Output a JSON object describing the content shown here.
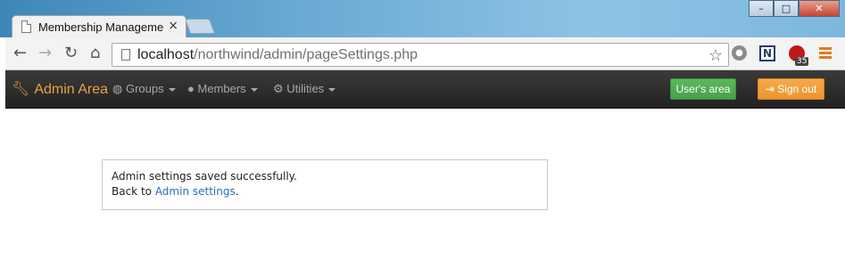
{
  "browser": {
    "tab_title": "Membership Managemen",
    "tab_close": "×",
    "window_buttons": {
      "minimize": "–",
      "maximize": "□",
      "close": "✕"
    },
    "url_host": "localhost",
    "url_path": "/northwind/admin/pageSettings.php",
    "extension_badge": "35",
    "extension_n_label": "N"
  },
  "navbar": {
    "brand": "Admin Area",
    "items": [
      {
        "label": "Groups",
        "icon": "globe-icon"
      },
      {
        "label": "Members",
        "icon": "user-icon"
      },
      {
        "label": "Utilities",
        "icon": "cog-icon"
      }
    ],
    "users_area_label": "User's area",
    "sign_out_label": "Sign out"
  },
  "message": {
    "line1": "Admin settings saved successfully.",
    "back_prefix": "Back to ",
    "link_text": "Admin settings",
    "back_suffix": "."
  },
  "colors": {
    "brand": "#e8a23f",
    "users_button": "#5cb85c",
    "signout_button": "#f0a040",
    "link": "#2a6ebb"
  }
}
